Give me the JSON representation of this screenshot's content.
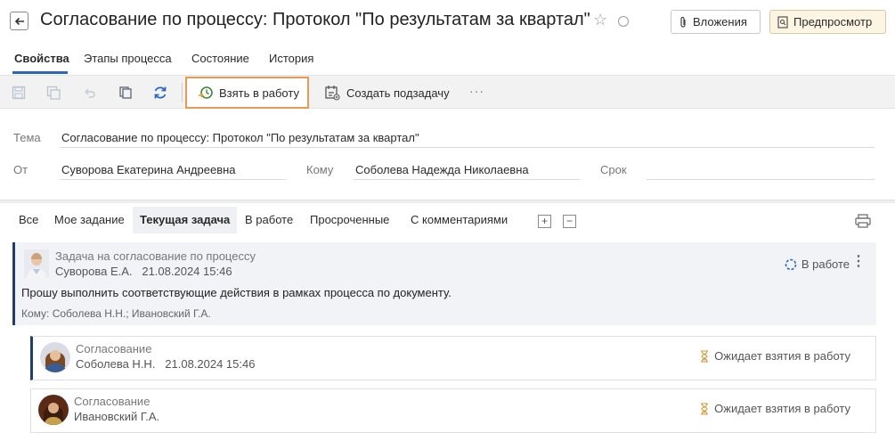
{
  "header": {
    "title": "Согласование по процессу: Протокол \"По результатам за квартал\"",
    "attachments_label": "Вложения",
    "preview_label": "Предпросмотр"
  },
  "tabs": [
    {
      "label": "Свойства",
      "active": true
    },
    {
      "label": "Этапы процесса",
      "active": false
    },
    {
      "label": "Состояние",
      "active": false
    },
    {
      "label": "История",
      "active": false
    }
  ],
  "toolbar": {
    "take_label": "Взять в работу",
    "subtask_label": "Создать подзадачу",
    "more_label": "···"
  },
  "form": {
    "subject_label": "Тема",
    "subject_value": "Согласование по процессу: Протокол \"По результатам за квартал\"",
    "from_label": "От",
    "from_value": "Суворова Екатерина Андреевна",
    "to_label": "Кому",
    "to_value": "Соболева Надежда Николаевна",
    "due_label": "Срок",
    "due_value": ""
  },
  "filters": [
    {
      "label": "Все",
      "active": false
    },
    {
      "label": "Мое задание",
      "active": false
    },
    {
      "label": "Текущая задача",
      "active": true
    },
    {
      "label": "В работе",
      "active": false
    },
    {
      "label": "Просроченные",
      "active": false
    },
    {
      "label": "С комментариями",
      "active": false
    }
  ],
  "filter_expand": "+",
  "filter_collapse": "−",
  "task": {
    "title": "Задача на согласование по процессу",
    "author_date": "Суворова Е.А.   21.08.2024 15:46",
    "body": "Прошу выполнить соответствующие действия в рамках процесса по документу.",
    "to": "Кому: Соболева Н.Н.; Ивановский Г.А.",
    "status": "В работе"
  },
  "subtasks": [
    {
      "title": "Согласование",
      "author_date": "Соболева Н.Н.   21.08.2024 15:46",
      "status": "Ожидает взятия в работу"
    },
    {
      "title": "Согласование",
      "author_date": "Ивановский Г.А.",
      "status": "Ожидает взятия в работу"
    }
  ],
  "colors": {
    "accent_blue": "#2c66b8",
    "card_accent": "#1f3e6b",
    "highlight_orange": "#e89a54"
  }
}
